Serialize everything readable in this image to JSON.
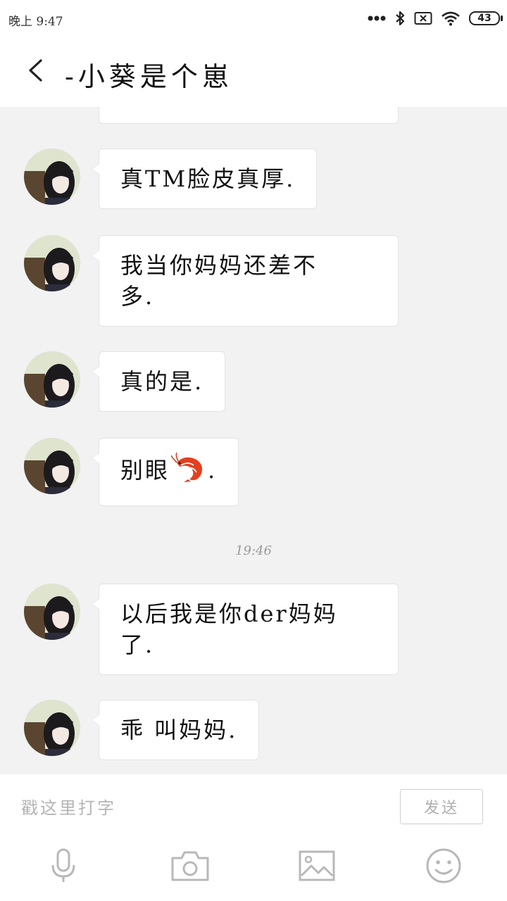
{
  "status_bar": {
    "time": "晚上 9:47",
    "battery_level": "43",
    "icons": [
      "signal-dots-icon",
      "bluetooth-icon",
      "sim-off-icon",
      "wifi-icon",
      "battery-icon"
    ]
  },
  "header": {
    "back_icon": "back-arrow-icon",
    "title": "-小葵是个崽"
  },
  "messages": [
    {
      "sender": "avatar",
      "text": "真TM脸皮真厚."
    },
    {
      "sender": "avatar",
      "text_line1": "我当你妈妈还差不",
      "text_line2": "多."
    },
    {
      "sender": "avatar",
      "text": "真的是."
    },
    {
      "sender": "avatar",
      "text_before": "别眼",
      "emoji": "shrimp-emoji",
      "text_after": "."
    },
    {
      "sender": "avatar",
      "text_line1": "以后我是你der妈妈",
      "text_line2": "了."
    },
    {
      "sender": "avatar",
      "text": "乖 叫妈妈."
    }
  ],
  "timestamp": "19:46",
  "composer": {
    "placeholder": "戳这里打字",
    "send_label": "发送"
  },
  "toolbar": {
    "items": [
      "microphone-icon",
      "camera-icon",
      "image-icon",
      "emoji-icon"
    ]
  },
  "colors": {
    "chat_background": "#f2f2f2",
    "bubble": "#ffffff",
    "muted_text": "#b5b5b5"
  }
}
